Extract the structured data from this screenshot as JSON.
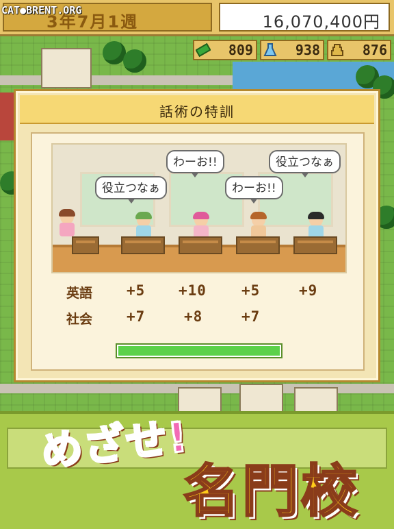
{
  "header": {
    "watermark": "CAT●BRENT.ORG",
    "date": "3年7月1週",
    "money": "16,070,400円"
  },
  "resources": [
    {
      "icon": "green-ticket-icon",
      "value": "809"
    },
    {
      "icon": "flask-icon",
      "value": "938"
    },
    {
      "icon": "trophy-stand-icon",
      "value": "876"
    }
  ],
  "dialog": {
    "title": "話術の特訓",
    "bubbles": [
      "わーお!!",
      "役立つなぁ",
      "役立つなぁ",
      "わーお!!"
    ],
    "stats": {
      "rows": [
        {
          "label": "英語",
          "values": [
            "+5",
            "+10",
            "+5",
            "+9"
          ]
        },
        {
          "label": "社会",
          "values": [
            "+7",
            "+8",
            "+7"
          ]
        }
      ]
    },
    "progress": 1.0
  },
  "banner": {
    "slogan_top": "めざせ!",
    "slogan_main": "名門校"
  },
  "colors": {
    "accent": "#e8c56a",
    "progress": "#5bd14a",
    "slogan_pink": "#f26bb5",
    "slogan_yellow": "#ffcc1a"
  }
}
